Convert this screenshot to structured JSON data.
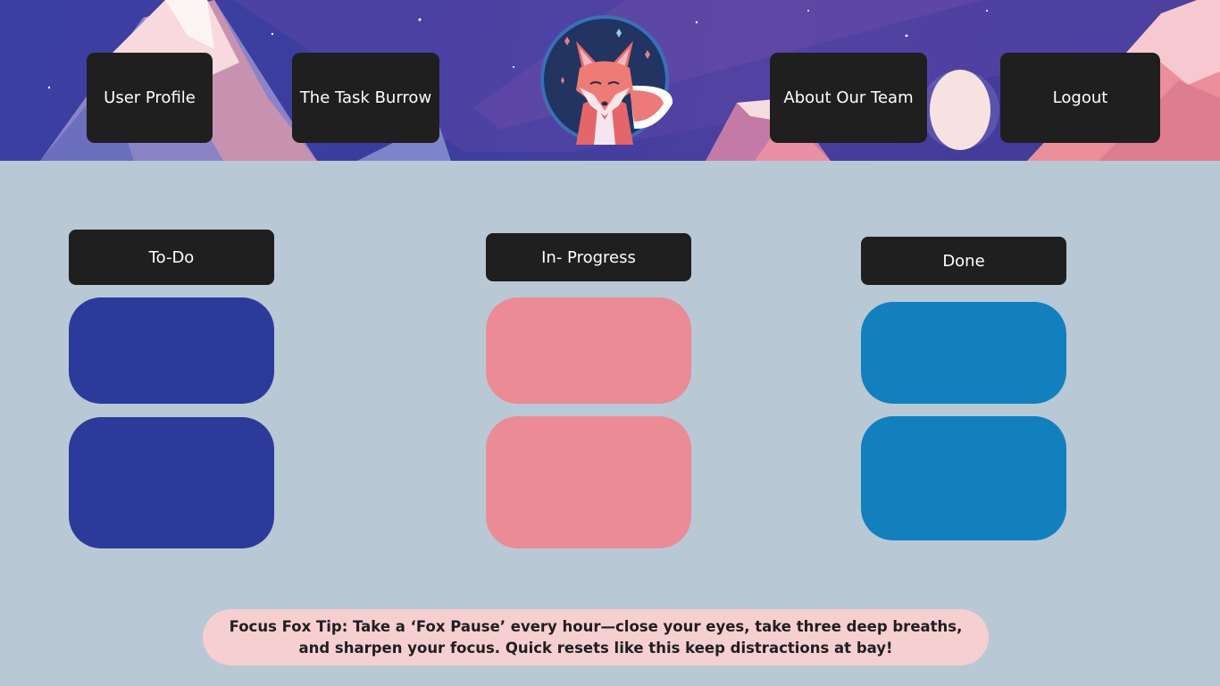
{
  "nav": {
    "user_profile": "User Profile",
    "task_burrow": "The Task Burrow",
    "about_team": "About Our Team",
    "logout": "Logout"
  },
  "columns": [
    {
      "title": "To-Do",
      "color": "#2c3b9a",
      "cards": 2
    },
    {
      "title": "In- Progress",
      "color": "#ea8b95",
      "cards": 2
    },
    {
      "title": "Done",
      "color": "#1380be",
      "cards": 2
    }
  ],
  "tip": {
    "text": "Focus Fox Tip: Take a ‘Fox Pause’ every hour—close your eyes, take three deep breaths, and sharpen your focus. Quick resets like this keep distractions at bay!"
  },
  "colors": {
    "page_background": "#b9c8d5",
    "button_background": "#1f1f1f",
    "tip_background": "#f6cfd0",
    "header_sky": "#3c3fa2"
  }
}
